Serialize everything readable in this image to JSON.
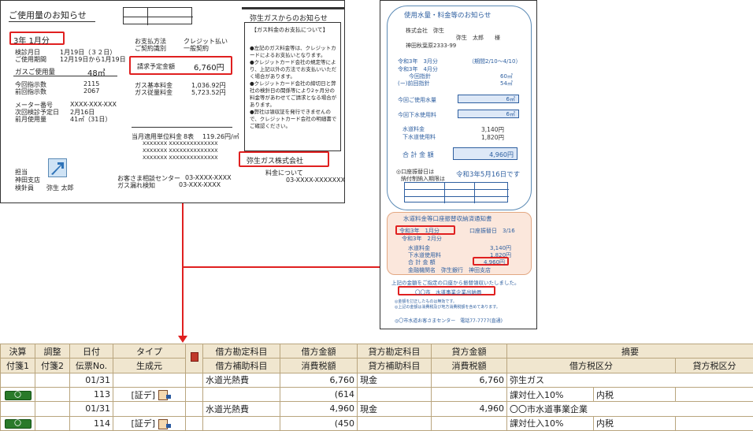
{
  "gas": {
    "title": "ご使用量のお知らせ",
    "month": "3年 1月分",
    "date_label1": "検診月日",
    "date_label2": "ご使用期間",
    "date_val1": "1月19日（３２日）",
    "date_val2": "12月19日から1月19日",
    "usage_label": "ガスご使用量",
    "usage_val": "48㎥",
    "cur_label": "今回指示数",
    "prev_label": "前回指示数",
    "cur_val": "2115",
    "prev_val": "2067",
    "meter_label": "メーター番号",
    "next_label": "次回検診予定日",
    "lastmon_label": "前月使用量",
    "meter_val": "XXXX-XXX-XXX",
    "next_val": "2月16日",
    "lastmon_val": "41㎥（31日）",
    "staff1": "担当",
    "staff2": "神田支店",
    "staff3": "検針員",
    "staff_name": "弥生 太郎",
    "pay_label1": "お支払方法",
    "pay_label2": "ご契約識別",
    "pay_val1": "クレジット払い",
    "pay_val2": "一般契約",
    "bill_label": "請求予定金額",
    "bill_val": "6,760円",
    "base_label": "ガス基本料金",
    "vol_label": "ガス従量料金",
    "base_val": "1,036.92円",
    "vol_val": "5,723.52円",
    "unit_label": "当月適用単位料金",
    "unit_tier": "8表",
    "unit_val": "119.26円/㎥",
    "x_line": "XXXXXXX  XXXXXXXXXXXXXX",
    "center_label": "お客さま相談センター",
    "center_tel": "03-XXXX-XXXX",
    "leak_label": "ガス漏れ検知",
    "leak_tel": "03-XXX-XXXX",
    "from_title": "弥生ガスからのお知らせ",
    "pay_head": "【ガス料金のお支払について】",
    "notes": [
      "●左記のガス料金等は、クレジットカードによるお支払いとなります。",
      "●クレジットカード会社の規定等により、上記以外の方法でお支払いいただく場合があります。",
      "●クレジットカード会社の締切日と弊社の検針日の関係等により2ヶ月分の料金等があわせてご請求となる場合があります。",
      "●弊社は領収証を発行できませんので、クレジットカード会社の明細書でご確認ください。"
    ],
    "company": "弥生ガス株式会社",
    "fee_label": "料金について",
    "fee_tel": "03-XXXX-XXXXXXX"
  },
  "water": {
    "title": "使用水量・料金等のお知らせ",
    "company": "株式会社　弥生",
    "recipient": "弥生　太郎　　様",
    "address": "神田秋葉原2333-99",
    "period1": "令和3年　3月分",
    "period1b": "（期間2/10～4/10）",
    "period2": "令和3年　4月分",
    "cur_label": "今回指針",
    "cur_val": "60㎥",
    "prev_label": "(ー)前回指針",
    "prev_val": "54㎥",
    "use_label": "今回ご使用水量",
    "use_val": "6㎥",
    "sew_use_label": "今回下水使用料",
    "sew_use_val": "6㎥",
    "wfee_label": "水道料金",
    "wfee_val": "3,140円",
    "sfee_label": "下水道使用料",
    "sfee_val": "1,820円",
    "total_label": "合 計 金 額",
    "total_val": "4,960円",
    "debit_label": "◎口座振替日は",
    "debit_label2": "納付制納入期限は",
    "debit_val": "令和3年5月16日です",
    "notice_title": "水道料金等口座振替収納済通知書",
    "notice_month": "令和3年　1月分",
    "notice_date": "口座振替日　3/16",
    "notice_sub": "令和3年　2月分",
    "n_wfee_label": "水道料金",
    "n_wfee_val": "3,140円",
    "n_sfee_label": "下水道使用料",
    "n_sfee_val": "1,820円",
    "n_total_label": "合 計 金 額",
    "n_total_val": "4,960円",
    "n_bank": "金融機関名　弥生銀行　神田支店",
    "receipt_note": "上記の金額をご指定の口座から振替領収いたしました。",
    "city_stamp": "〇〇市　水道事業企業出納員",
    "small1": "◎金額を訂正したものは無効です。",
    "small2": "◎上記の金額は消費税及び地方消費税額を含めてあります。",
    "center": "◎〇市水道お客さまセンター　電話77-7777(直通)"
  },
  "table": {
    "headers1": [
      "決算",
      "調整",
      "日付",
      "タイプ",
      "借方勘定科目",
      "借方金額",
      "貸方勘定科目",
      "貸方金額",
      "摘要"
    ],
    "headers2": [
      "付箋1",
      "付箋2",
      "伝票No.",
      "生成元",
      "借方補助科目",
      "消費税額",
      "貸方補助科目",
      "消費税額",
      "借方税区分",
      "貸方税区分"
    ],
    "rows": [
      {
        "date": "01/31",
        "account": "水道光熱費",
        "amount": "6,760",
        "credit": "現金",
        "credit_amt": "6,760",
        "memo": "弥生ガス",
        "no": "113",
        "src": "[証デ]",
        "tax": "(614",
        "tax_div": "課対仕入10%",
        "incl": "内税"
      },
      {
        "date": "01/31",
        "account": "水道光熱費",
        "amount": "4,960",
        "credit": "現金",
        "credit_amt": "4,960",
        "memo": "〇〇市水道事業企業",
        "no": "114",
        "src": "[証デ]",
        "tax": "(450",
        "tax_div": "課対仕入10%",
        "incl": "内税"
      }
    ],
    "badge": "〇"
  }
}
